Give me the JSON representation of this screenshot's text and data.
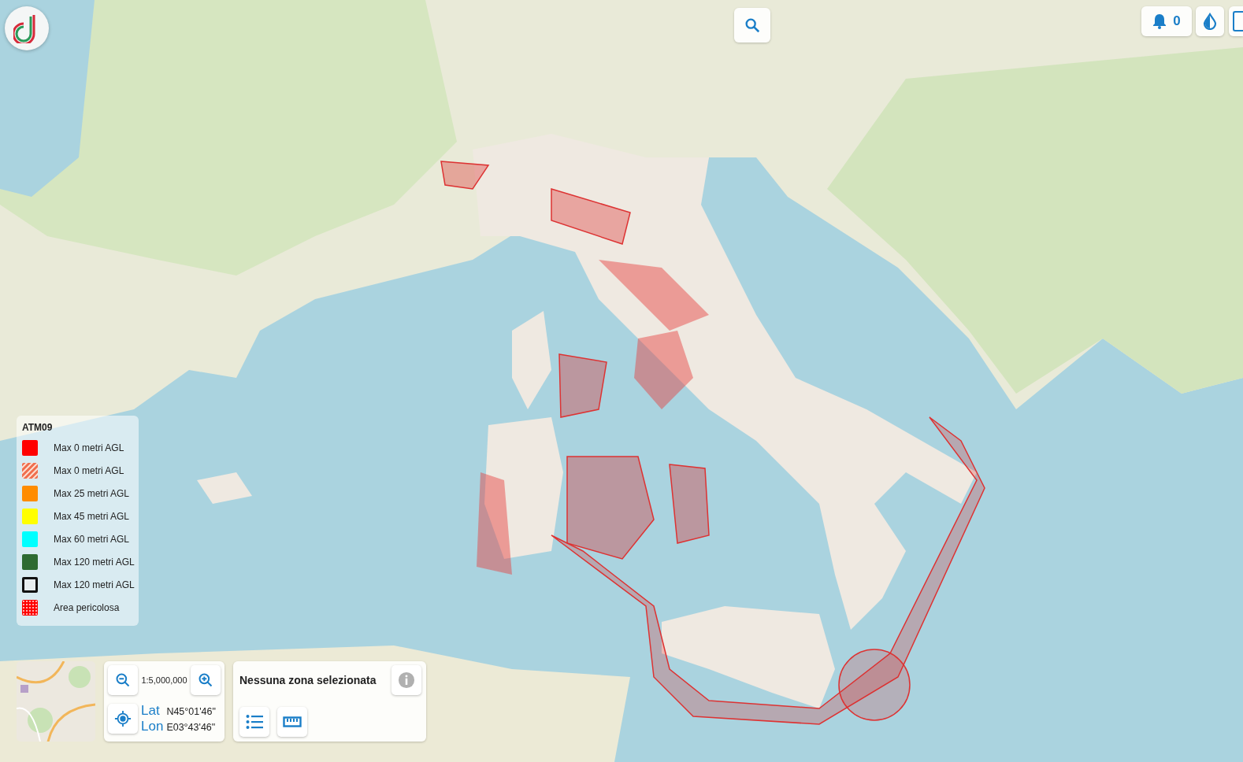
{
  "top_bar": {
    "notifications": {
      "count": "0"
    }
  },
  "legend": {
    "title": "ATM09",
    "items": [
      {
        "label": "Max 0 metri AGL",
        "kind": "solid",
        "color": "#ff0000"
      },
      {
        "label": "Max 0 metri AGL",
        "kind": "hatched",
        "color": "#f07050"
      },
      {
        "label": "Max 25 metri AGL",
        "kind": "solid",
        "color": "#ff8c00"
      },
      {
        "label": "Max 45 metri AGL",
        "kind": "solid",
        "color": "#ffff00"
      },
      {
        "label": "Max 60 metri AGL",
        "kind": "solid",
        "color": "#00ffff"
      },
      {
        "label": "Max 120 metri AGL",
        "kind": "solid",
        "color": "#2e6b32"
      },
      {
        "label": "Max 120 metri AGL",
        "kind": "outline",
        "color": "#111111"
      },
      {
        "label": "Area pericolosa",
        "kind": "dotted",
        "color": "#ff0000"
      }
    ]
  },
  "zoom_panel": {
    "scale": "1:5,000,000",
    "lat_label": "Lat",
    "lat": "N45°01'46\"",
    "lon_label": "Lon",
    "lon": "E03°43'46\""
  },
  "zone_panel": {
    "title": "Nessuna zona selezionata"
  }
}
